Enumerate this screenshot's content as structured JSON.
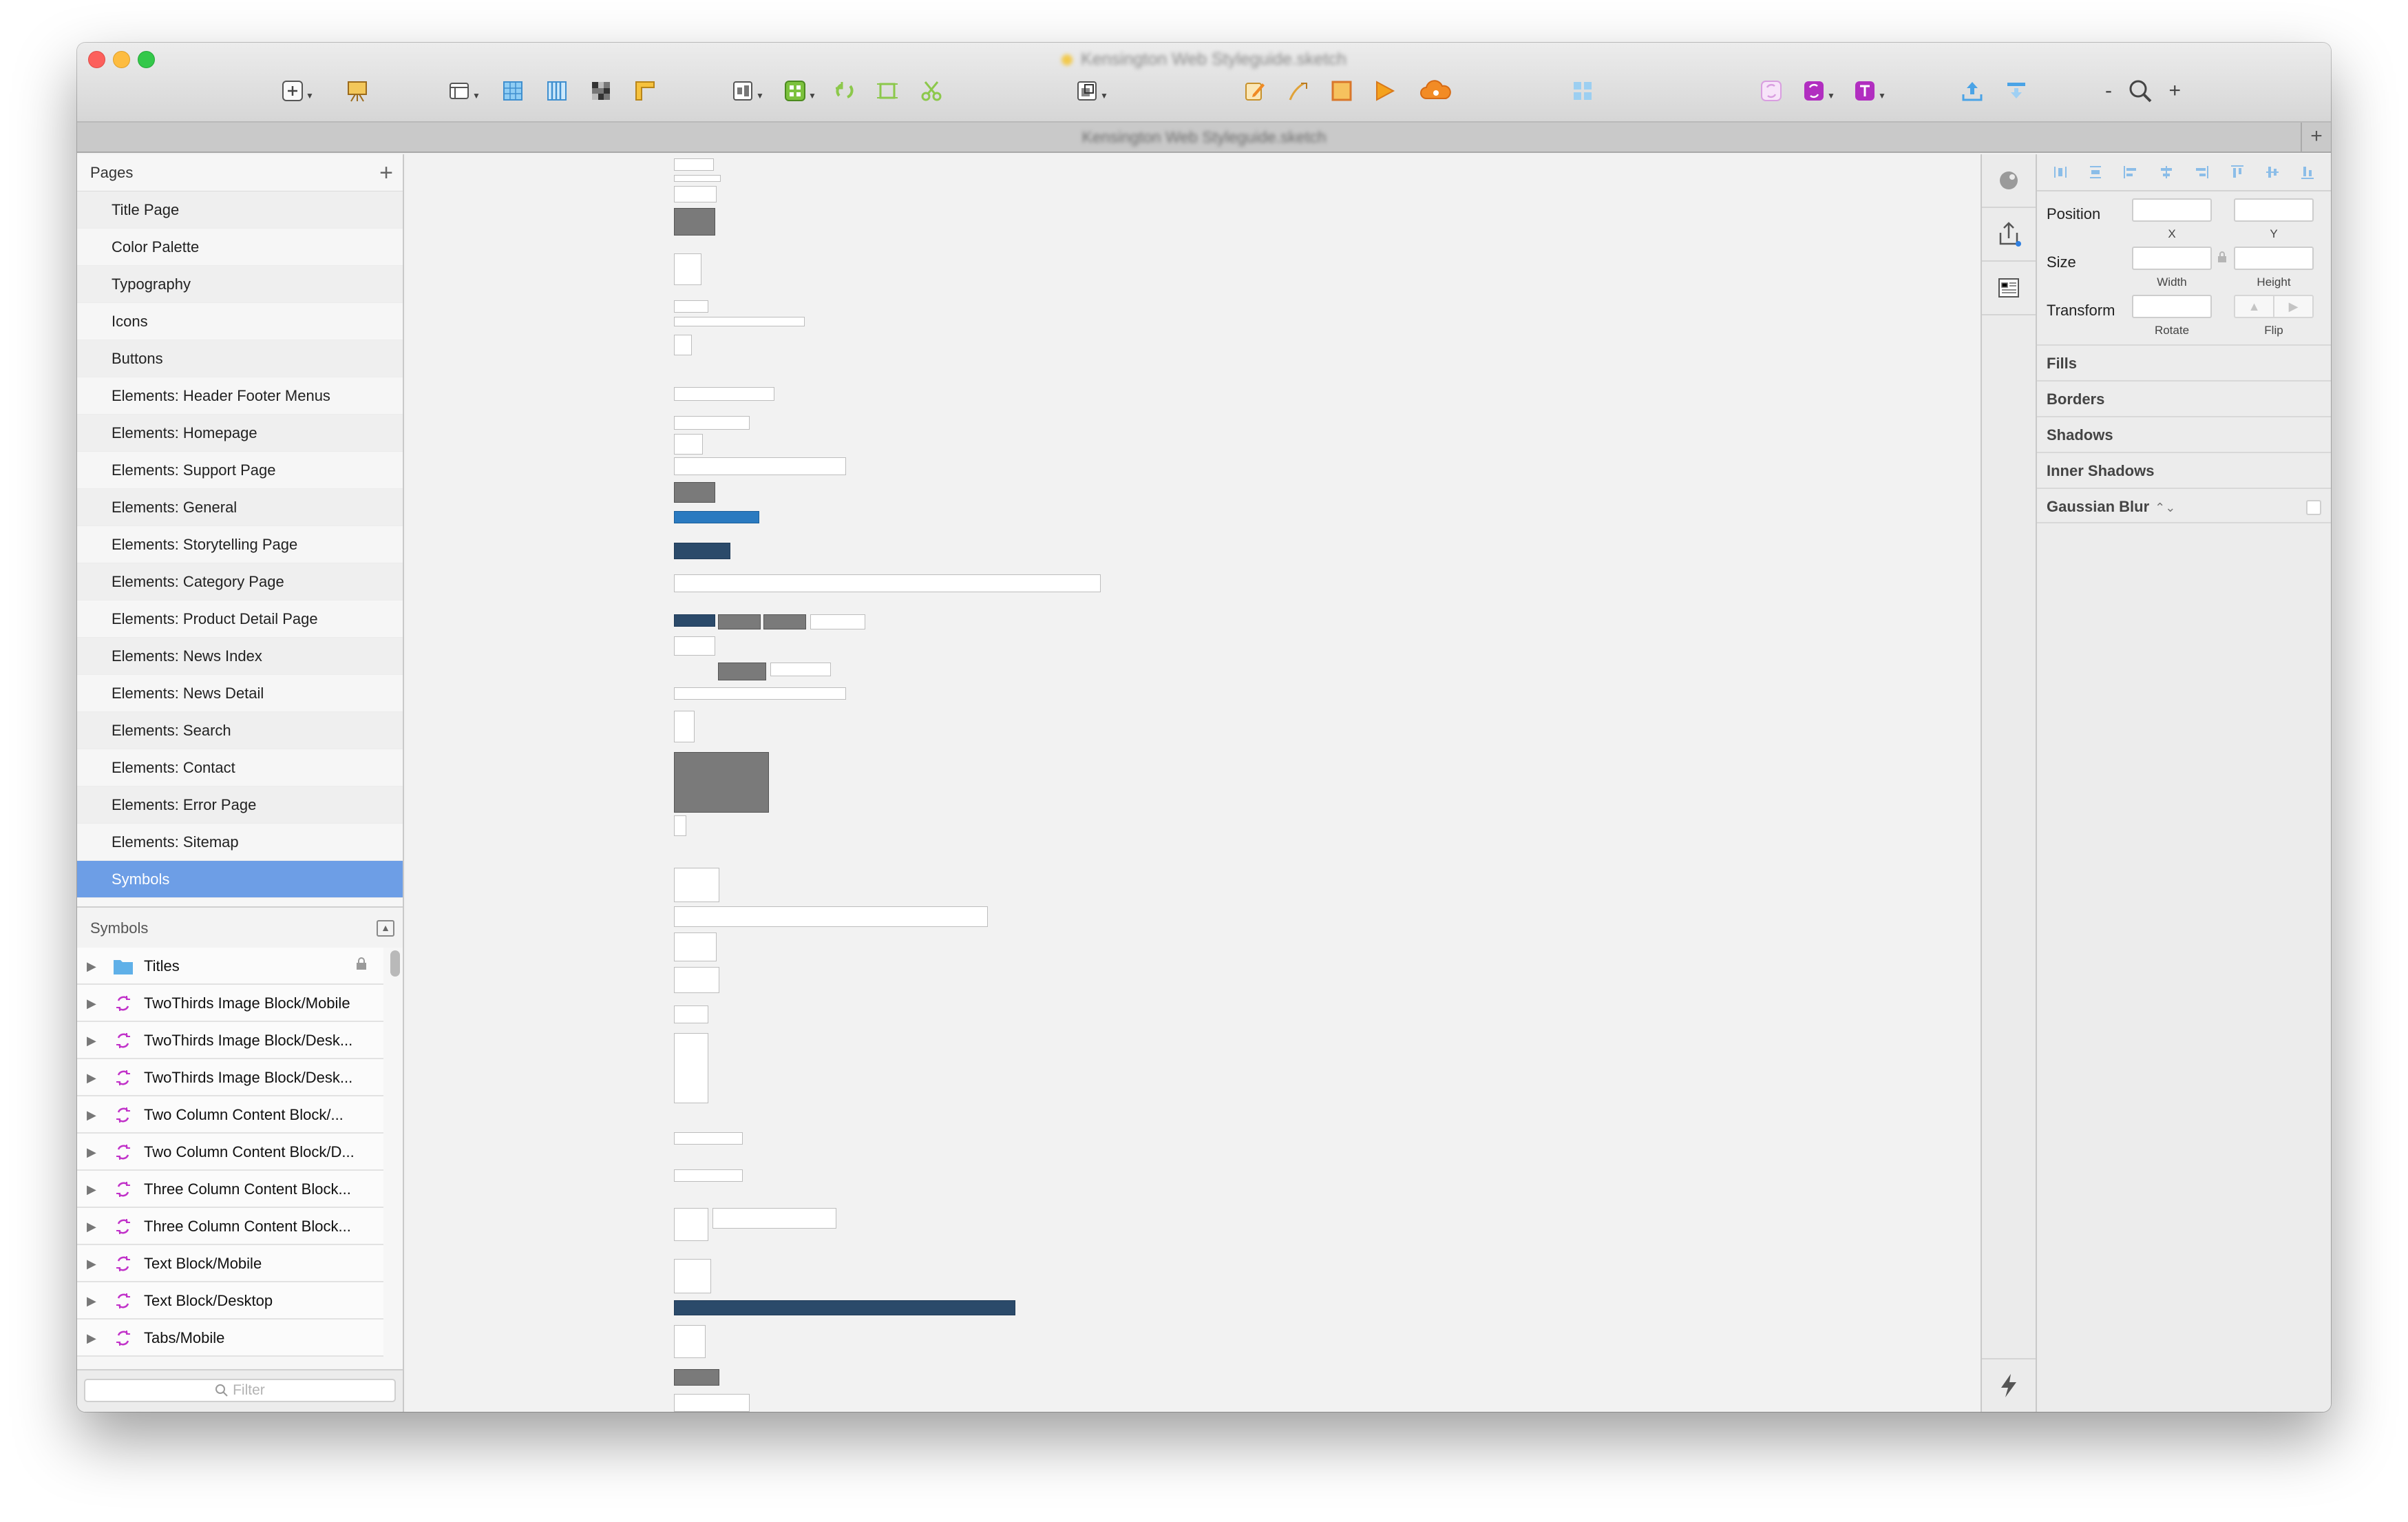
{
  "window": {
    "title": "Kensington Web Styleguide.sketch",
    "tab_title": "Kensington Web Styleguide.sketch",
    "tab_add": "+"
  },
  "toolbar": {
    "zoom_minus": "-",
    "zoom_plus": "+"
  },
  "pages": {
    "header": "Pages",
    "add": "+",
    "items": [
      "Title Page",
      "Color Palette",
      "Typography",
      "Icons",
      "Buttons",
      "Elements: Header Footer Menus",
      "Elements: Homepage",
      "Elements: Support Page",
      "Elements: General",
      "Elements: Storytelling Page",
      "Elements: Category Page",
      "Elements: Product Detail Page",
      "Elements: News Index",
      "Elements: News Detail",
      "Elements: Search",
      "Elements: Contact",
      "Elements: Error Page",
      "Elements: Sitemap",
      "Symbols"
    ],
    "selected": "Symbols"
  },
  "symbols": {
    "header": "Symbols",
    "items": [
      {
        "label": "Titles",
        "type": "folder",
        "locked": true
      },
      {
        "label": "TwoThirds Image Block/Mobile",
        "type": "symbol"
      },
      {
        "label": "TwoThirds Image Block/Desk...",
        "type": "symbol"
      },
      {
        "label": "TwoThirds Image Block/Desk...",
        "type": "symbol"
      },
      {
        "label": "Two Column Content Block/...",
        "type": "symbol"
      },
      {
        "label": "Two Column Content Block/D...",
        "type": "symbol"
      },
      {
        "label": "Three Column Content Block...",
        "type": "symbol"
      },
      {
        "label": "Three Column Content Block...",
        "type": "symbol"
      },
      {
        "label": "Text Block/Mobile",
        "type": "symbol"
      },
      {
        "label": "Text Block/Desktop",
        "type": "symbol"
      },
      {
        "label": "Tabs/Mobile",
        "type": "symbol"
      }
    ],
    "filter_placeholder": "Filter"
  },
  "inspector": {
    "position_label": "Position",
    "x_label": "X",
    "y_label": "Y",
    "size_label": "Size",
    "width_label": "Width",
    "height_label": "Height",
    "transform_label": "Transform",
    "rotate_label": "Rotate",
    "flip_label": "Flip",
    "sections": [
      "Fills",
      "Borders",
      "Shadows",
      "Inner Shadows",
      "Gaussian Blur"
    ],
    "blur_stepper": "⌃⌄"
  },
  "colors": {
    "selection": "#6d9ee6",
    "symbol_icon": "#c133c9",
    "folder": "#5fb0e8"
  }
}
